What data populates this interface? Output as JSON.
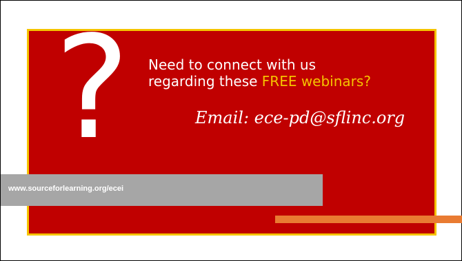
{
  "slide": {
    "question_glyph": "?",
    "heading_line1": "Need to connect with us",
    "heading_line2_prefix": "regarding these ",
    "heading_highlight": "FREE webinars?",
    "email_line": "Email: ece-pd@sflinc.org",
    "url": "www.sourceforlearning.org/ecei"
  },
  "colors": {
    "panel_background": "#c00000",
    "panel_border": "#f5c400",
    "highlight_text": "#f5c400",
    "url_bar": "#a6a6a6",
    "accent_bar": "#e97b32"
  }
}
